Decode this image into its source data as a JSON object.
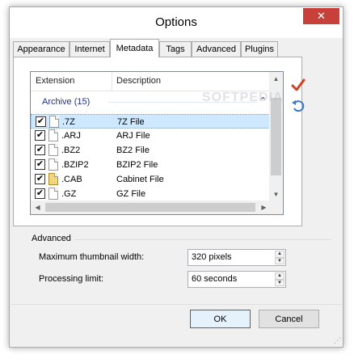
{
  "window": {
    "title": "Options",
    "close_glyph": "✕"
  },
  "tabs": [
    {
      "label": "Appearance",
      "active": false
    },
    {
      "label": "Internet",
      "active": false
    },
    {
      "label": "Metadata",
      "active": true
    },
    {
      "label": "Tags",
      "active": false
    },
    {
      "label": "Advanced",
      "active": false
    },
    {
      "label": "Plugins",
      "active": false
    }
  ],
  "list": {
    "columns": [
      "Extension",
      "Description"
    ],
    "group": {
      "label": "Archive (15)",
      "chevron": "⌃"
    },
    "rows": [
      {
        "ext": ".7Z",
        "desc": "7Z File",
        "checked": true,
        "selected": true,
        "icon": "file-icon"
      },
      {
        "ext": ".ARJ",
        "desc": "ARJ File",
        "checked": true,
        "selected": false,
        "icon": "file-icon"
      },
      {
        "ext": ".BZ2",
        "desc": "BZ2 File",
        "checked": true,
        "selected": false,
        "icon": "file-icon"
      },
      {
        "ext": ".BZIP2",
        "desc": "BZIP2 File",
        "checked": true,
        "selected": false,
        "icon": "file-icon"
      },
      {
        "ext": ".CAB",
        "desc": "Cabinet File",
        "checked": true,
        "selected": false,
        "icon": "cabinet-icon"
      },
      {
        "ext": ".GZ",
        "desc": "GZ File",
        "checked": true,
        "selected": false,
        "icon": "file-icon"
      }
    ],
    "check_glyph": "✔"
  },
  "side_buttons": {
    "check_all_icon": "checkmark-icon",
    "reset_icon": "undo-icon"
  },
  "advanced": {
    "heading": "Advanced",
    "thumbnail_label": "Maximum thumbnail width:",
    "thumbnail_value": "320 pixels",
    "processing_label": "Processing limit:",
    "processing_value": "60 seconds"
  },
  "buttons": {
    "ok": "OK",
    "cancel": "Cancel"
  },
  "watermark": "SOFTPEDIA",
  "colors": {
    "close": "#c7403a",
    "group_text": "#1e3287",
    "selection": "#cde8ff",
    "checkmark_red": "#d04020"
  }
}
